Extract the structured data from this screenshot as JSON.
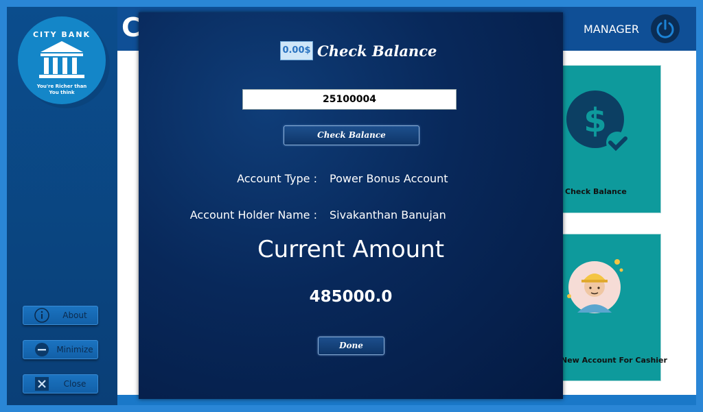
{
  "sidebar": {
    "logo": {
      "bank_name": "CITY BANK",
      "tagline_line1": "You're Richer than",
      "tagline_line2": "You think"
    },
    "buttons": [
      {
        "label": "About",
        "icon": "info-icon"
      },
      {
        "label": "Minimize",
        "icon": "minus-icon"
      },
      {
        "label": "Close",
        "icon": "close-icon"
      }
    ]
  },
  "header": {
    "partial_title": "C",
    "role": "MANAGER",
    "power_icon": "power-icon"
  },
  "cards": [
    {
      "label": "Check Balance",
      "icon": "dollar-check-icon"
    },
    {
      "label": "New Account For Cashier",
      "icon": "worker-avatar-icon"
    }
  ],
  "dialog": {
    "title": "Check Balance",
    "title_icon_text": "0.00$",
    "account_number": "25100004",
    "check_button": "Check Balance",
    "account_type_label": "Account Type :",
    "account_type_value": "Power Bonus Account",
    "holder_label": "Account Holder Name :",
    "holder_value": "Sivakanthan Banujan",
    "current_amount_label": "Current Amount",
    "amount": "485000.0",
    "done_button": "Done"
  },
  "colors": {
    "dialog_bg": "#08285a",
    "sidebar_bg": "#0b4d8d",
    "card_teal": "#0e9a9c",
    "accent_blue": "#1a78c8"
  }
}
